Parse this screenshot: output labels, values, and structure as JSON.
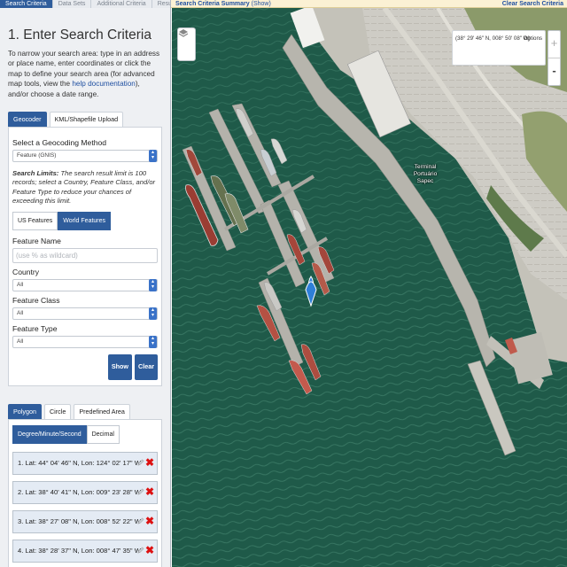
{
  "left_tabs": [
    "Search Criteria",
    "Data Sets",
    "Additional Criteria",
    "Results"
  ],
  "section_title": "1. Enter Search Criteria",
  "intro_text": "To narrow your search area: type in an address or place name, enter coordinates or click the map to define your search area (for advanced map tools, view the ",
  "intro_link": "help documentation",
  "intro_tail": "), and/or choose a date range.",
  "geo_tabs": [
    "Geocoder",
    "KML/Shapefile Upload"
  ],
  "method_label": "Select a Geocoding Method",
  "method_value": "Feature (GNIS)",
  "limits_bold": "Search Limits:",
  "limits_text": " The search result limit is 100 records; select a Country, Feature Class, and/or Feature Type to reduce your chances of exceeding this limit.",
  "feature_toggle": [
    "US Features",
    "World Features"
  ],
  "feature_name_label": "Feature Name",
  "feature_name_placeholder": "(use % as wildcard)",
  "country_label": "Country",
  "country_value": "All",
  "class_label": "Feature Class",
  "class_value": "All",
  "type_label": "Feature Type",
  "type_value": "All",
  "show_label": "Show",
  "clear_label": "Clear",
  "area_tabs": [
    "Polygon",
    "Circle",
    "Predefined Area"
  ],
  "unit_toggle": [
    "Degree/Minute/Second",
    "Decimal"
  ],
  "coordinates": [
    "1. Lat: 44° 04' 46\" N, Lon: 124° 02' 17\" W",
    "2. Lat: 38° 40' 41\" N, Lon: 009° 23' 28\" W",
    "3. Lat: 38° 27' 08\" N, Lon: 008° 52' 22\" W",
    "4. Lat: 38° 28' 37\" N, Lon: 008° 47' 35\" W"
  ],
  "topbar_title": "Search Criteria Summary",
  "topbar_show": "(Show)",
  "topbar_clear": "Clear Search Criteria",
  "map_coords": "(38° 29' 46\" N, 008° 50' 08\" W)",
  "map_options": "Options",
  "zoom_in": "+",
  "zoom_out": "-",
  "map_label": "Terminal Portuário Sapec",
  "colors": {
    "accent": "#2f5d9c",
    "link": "#1f4fa0",
    "water": "#1f5a49",
    "remove": "#d11111",
    "topbar_bg": "#fbf1d4"
  }
}
